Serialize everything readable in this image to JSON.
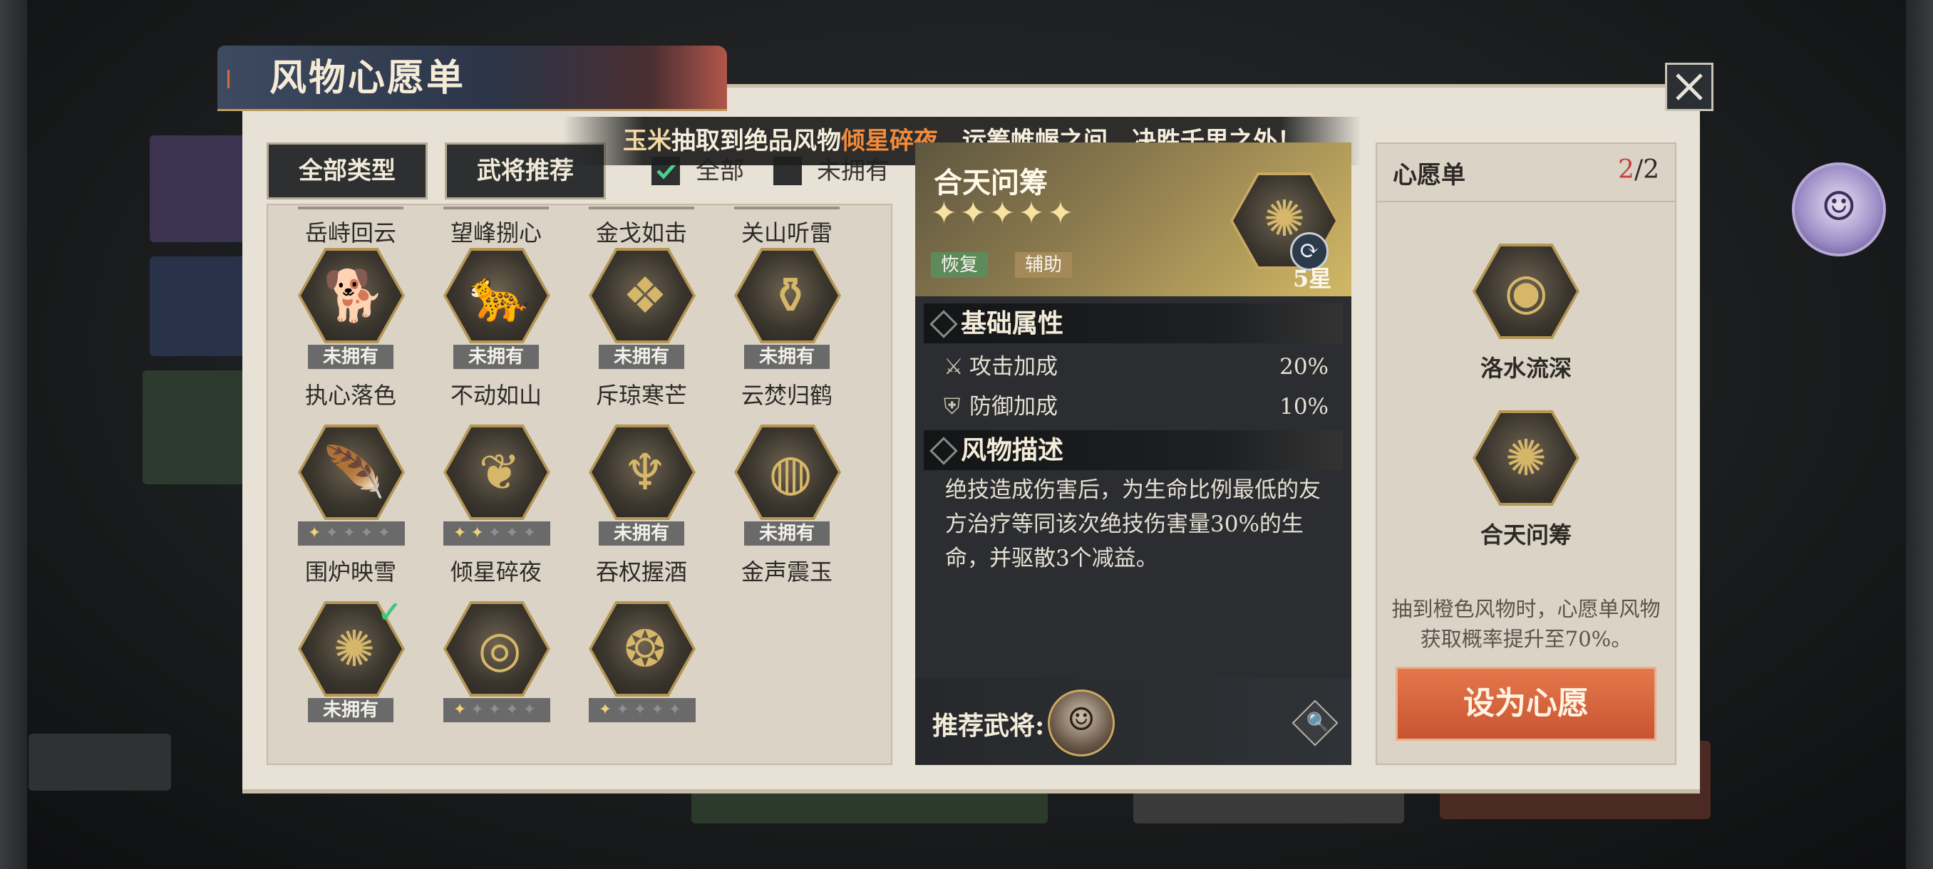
{
  "dialog": {
    "title": "风物心愿单",
    "close_label": "✕"
  },
  "announcement": {
    "user": "玉米",
    "text_a": "抽取到绝品风物",
    "item": "倾星碎夜",
    "text_b": "，运筹帷幄之间，决胜千里之外！"
  },
  "filters": {
    "all_types": "全部类型",
    "general_rec": "武将推荐",
    "check_all": "全部",
    "check_unowned": "未拥有"
  },
  "grid": {
    "top_names": [
      "岳峙回云",
      "望峰捌心",
      "金戈如击",
      "关山听雷"
    ],
    "rows": [
      [
        {
          "name": "执心落色",
          "glyph": "🐕",
          "status": "未拥有",
          "stars": 0
        },
        {
          "name": "不动如山",
          "glyph": "🐆",
          "status": "未拥有",
          "stars": 0
        },
        {
          "name": "斥琼寒芒",
          "glyph": "❖",
          "status": "未拥有",
          "stars": 0
        },
        {
          "name": "云焚归鹤",
          "glyph": "⚱",
          "status": "未拥有",
          "stars": 0
        }
      ],
      [
        {
          "name": "围炉映雪",
          "glyph": "🪶",
          "status": "",
          "stars": 1
        },
        {
          "name": "倾星碎夜",
          "glyph": "❦",
          "status": "",
          "stars": 2
        },
        {
          "name": "吞权握酒",
          "glyph": "♆",
          "status": "未拥有",
          "stars": 0
        },
        {
          "name": "金声震玉",
          "glyph": "◍",
          "status": "未拥有",
          "stars": 0
        }
      ],
      [
        {
          "name": "",
          "glyph": "✺",
          "status": "未拥有",
          "stars": 0,
          "checked": true
        },
        {
          "name": "",
          "glyph": "◎",
          "status": "",
          "stars": 1
        },
        {
          "name": "",
          "glyph": "❂",
          "status": "",
          "stars": 1
        }
      ]
    ]
  },
  "detail": {
    "name": "合天问筹",
    "stars": "✦✦✦✦✦",
    "tags": [
      "恢复",
      "辅助"
    ],
    "grade": "5星",
    "icon_glyph": "✺",
    "section_base": "基础属性",
    "attrs": [
      {
        "label": "攻击加成",
        "value": "20%",
        "icon": "⚔"
      },
      {
        "label": "防御加成",
        "value": "10%",
        "icon": "⛨"
      }
    ],
    "section_desc": "风物描述",
    "description": "绝技造成伤害后，为生命比例最低的友方治疗等同该次绝技伤害量30%的生命，并驱散3个减益。",
    "rec_label": "推荐武将:",
    "rec_avatar_glyph": "☺",
    "search_glyph": "🔍"
  },
  "wishlist": {
    "title": "心愿单",
    "count_current": "2",
    "count_sep_total": "/2",
    "items": [
      {
        "name": "洛水流深",
        "glyph": "◉"
      },
      {
        "name": "合天问筹",
        "glyph": "✺"
      }
    ],
    "note": "抽到橙色风物时，心愿单风物获取概率提升至70%。",
    "button": "设为心愿"
  },
  "side_avatar_glyph": "☺",
  "colors": {
    "accent_orange": "#f28b3b",
    "wish_button": "#c85531",
    "count_red": "#c2433b",
    "gold": "#c9a861"
  }
}
